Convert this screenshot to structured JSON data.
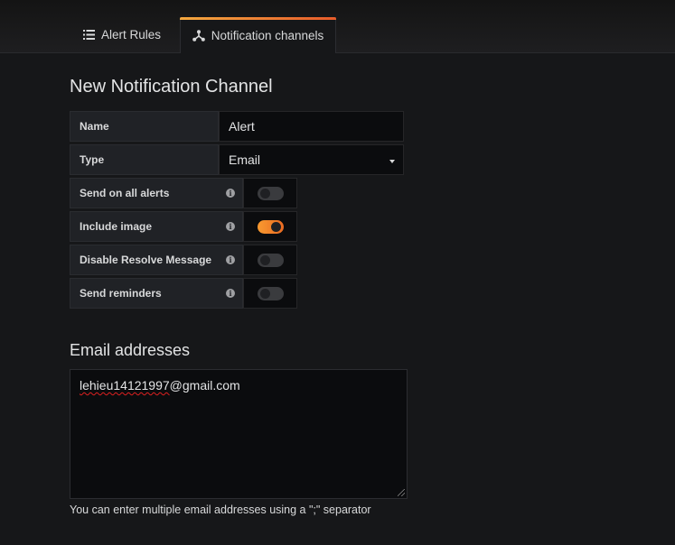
{
  "tabs": {
    "alert_rules": "Alert Rules",
    "notification_channels": "Notification channels"
  },
  "page_title": "New Notification Channel",
  "form": {
    "name_label": "Name",
    "name_value": "Alert",
    "type_label": "Type",
    "type_value": "Email",
    "toggles": [
      {
        "label": "Send on all alerts",
        "on": false
      },
      {
        "label": "Include image",
        "on": true
      },
      {
        "label": "Disable Resolve Message",
        "on": false
      },
      {
        "label": "Send reminders",
        "on": false
      }
    ]
  },
  "email_section": {
    "title": "Email addresses",
    "value_misspelled_part": "lehieu14121997",
    "value_rest": "@gmail.com",
    "help_text": "You can enter multiple email addresses using a \";\" separator"
  },
  "colors": {
    "accent": "#eb7b18",
    "background": "#161719"
  }
}
